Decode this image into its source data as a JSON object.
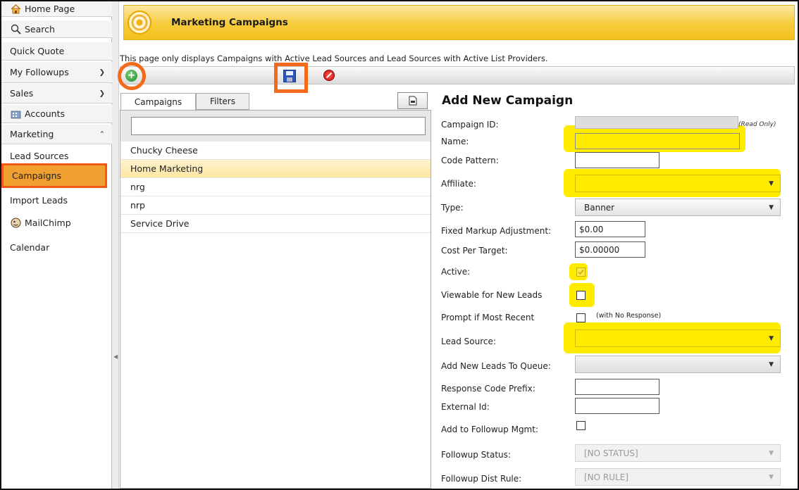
{
  "sidebar": {
    "items": [
      {
        "label": "Home Page",
        "icon": "home-icon"
      },
      {
        "label": "Search",
        "icon": "search-icon"
      },
      {
        "label": "Quick Quote"
      },
      {
        "label": "My Followups"
      },
      {
        "label": "Sales"
      },
      {
        "label": "Accounts",
        "icon": "accounts-icon"
      },
      {
        "label": "Marketing"
      },
      {
        "label": "Lead Sources"
      },
      {
        "label": "Campaigns"
      },
      {
        "label": "Import Leads"
      },
      {
        "label": "MailChimp",
        "icon": "mailchimp-icon"
      },
      {
        "label": "Calendar"
      }
    ]
  },
  "header": {
    "title": "Marketing Campaigns"
  },
  "info_text": "This page only displays Campaigns with Active Lead Sources and Lead Sources with Active List Providers.",
  "tabs": {
    "campaigns": "Campaigns",
    "filters": "Filters"
  },
  "campaign_list": {
    "search_value": "",
    "items": [
      "Chucky Cheese",
      "Home Marketing",
      "nrg",
      "nrp",
      "Service Drive"
    ],
    "selected": "Home Marketing"
  },
  "form": {
    "title": "Add New Campaign",
    "campaign_id_label": "Campaign ID:",
    "read_only_note": "(Read Only)",
    "name_label": "Name:",
    "code_pattern_label": "Code Pattern:",
    "affiliate_label": "Affiliate:",
    "type_label": "Type:",
    "type_value": "Banner",
    "fixed_markup_label": "Fixed Markup Adjustment:",
    "fixed_markup_value": "$0.00",
    "cost_per_target_label": "Cost Per Target:",
    "cost_per_target_value": "$0.00000",
    "active_label": "Active:",
    "viewable_label": "Viewable for New Leads",
    "prompt_label": "Prompt if Most Recent",
    "prompt_note": "(with No Response)",
    "lead_source_label": "Lead Source:",
    "queue_label": "Add New Leads To Queue:",
    "response_prefix_label": "Response Code Prefix:",
    "external_id_label": "External Id:",
    "followup_mgmt_label": "Add to Followup Mgmt:",
    "followup_status_label": "Followup Status:",
    "followup_status_value": "[NO STATUS]",
    "followup_rule_label": "Followup Dist Rule:",
    "followup_rule_value": "[NO RULE]"
  },
  "colors": {
    "header": "#f5c526",
    "highlight_orange": "#f26a1b",
    "marker_yellow": "#ffeb00"
  }
}
